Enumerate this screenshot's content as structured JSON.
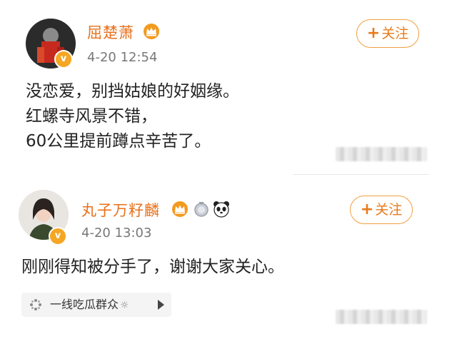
{
  "colors": {
    "username": "#e8701a",
    "follow_border": "#f0a040",
    "verified_badge": "#f5a623"
  },
  "posts": [
    {
      "username": "屈楚萧",
      "time": "4-20 12:54",
      "follow_label": "关注",
      "follow_plus": "+",
      "verified_mark": "v",
      "badges": [
        "crown-icon"
      ],
      "content": [
        "没恋爱，别挡姑娘的好姻缘。",
        "红螺寺风景不错，",
        "60公里提前蹲点辛苦了。"
      ]
    },
    {
      "username": "丸子万籽麟",
      "time": "4-20 13:03",
      "follow_label": "关注",
      "follow_plus": "+",
      "verified_mark": "v",
      "badges": [
        "crown-icon",
        "silver-medal-icon",
        "panda-icon"
      ],
      "content": [
        "刚刚得知被分手了，谢谢大家关心。"
      ],
      "source": {
        "label": "一线吃瓜群众",
        "suffix": "☼"
      }
    }
  ]
}
